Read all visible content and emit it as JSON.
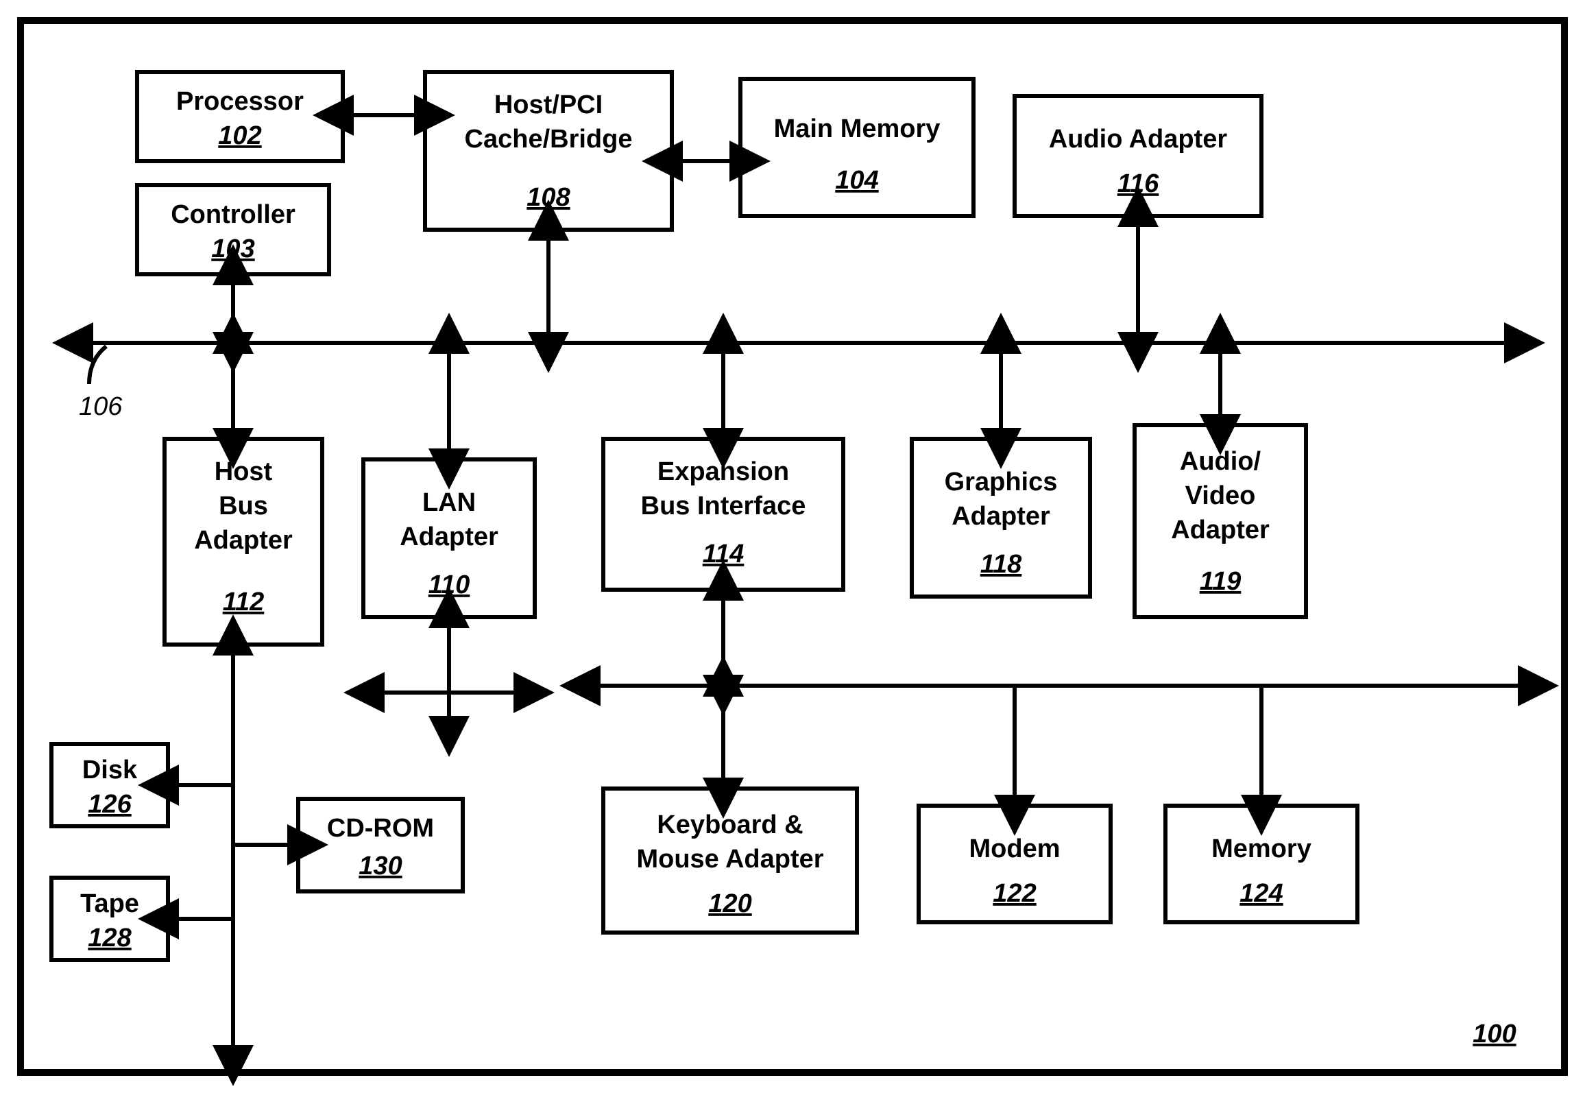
{
  "diagram": {
    "system_ref": "100",
    "bus_ref": "106",
    "blocks": {
      "processor": {
        "label": "Processor",
        "ref": "102"
      },
      "controller": {
        "label": "Controller",
        "ref": "103"
      },
      "bridge": {
        "line1": "Host/PCI",
        "line2": "Cache/Bridge",
        "ref": "108"
      },
      "main_memory": {
        "label": "Main Memory",
        "ref": "104"
      },
      "audio_adapter": {
        "label": "Audio Adapter",
        "ref": "116"
      },
      "host_bus": {
        "line1": "Host",
        "line2": "Bus",
        "line3": "Adapter",
        "ref": "112"
      },
      "lan": {
        "line1": "LAN",
        "line2": "Adapter",
        "ref": "110"
      },
      "expansion": {
        "line1": "Expansion",
        "line2": "Bus Interface",
        "ref": "114"
      },
      "graphics": {
        "line1": "Graphics",
        "line2": "Adapter",
        "ref": "118"
      },
      "av": {
        "line1": "Audio/",
        "line2": "Video",
        "line3": "Adapter",
        "ref": "119"
      },
      "disk": {
        "label": "Disk",
        "ref": "126"
      },
      "tape": {
        "label": "Tape",
        "ref": "128"
      },
      "cdrom": {
        "label": "CD-ROM",
        "ref": "130"
      },
      "kbm": {
        "line1": "Keyboard &",
        "line2": "Mouse Adapter",
        "ref": "120"
      },
      "modem": {
        "label": "Modem",
        "ref": "122"
      },
      "memory": {
        "label": "Memory",
        "ref": "124"
      }
    }
  }
}
